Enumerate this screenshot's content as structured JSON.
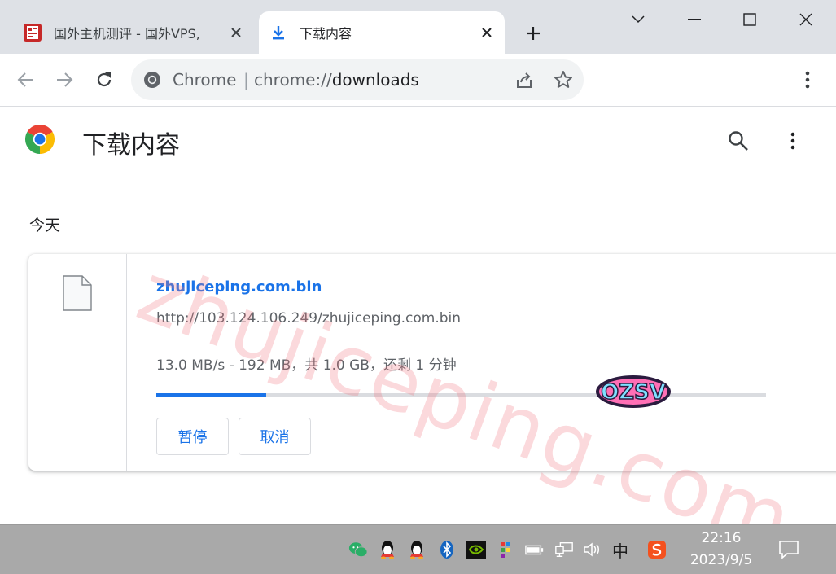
{
  "tabs": [
    {
      "title": "国外主机测评 - 国外VPS,",
      "active": false
    },
    {
      "title": "下载内容",
      "active": true
    }
  ],
  "omnibox": {
    "site_chip": "Chrome",
    "separator": "|",
    "url_scheme": "chrome://",
    "url_host": "downloads"
  },
  "page": {
    "title": "下载内容",
    "section_date": "今天"
  },
  "download": {
    "file_name": "zhujiceping.com.bin",
    "url": "http://103.124.106.249/zhujiceping.com.bin",
    "status": "13.0 MB/s - 192 MB，共 1.0 GB，还剩 1 分钟",
    "progress_fraction": 0.18,
    "pause_label": "暂停",
    "cancel_label": "取消"
  },
  "watermark": {
    "text": "zhujiceping.com",
    "sticker_text": "OZSV"
  },
  "taskbar": {
    "ime": "中",
    "time": "22:16",
    "date": "2023/9/5"
  },
  "colors": {
    "accent": "#1a73e8",
    "tabstrip": "#dee1e6",
    "taskbar": "#a9a9a9"
  }
}
